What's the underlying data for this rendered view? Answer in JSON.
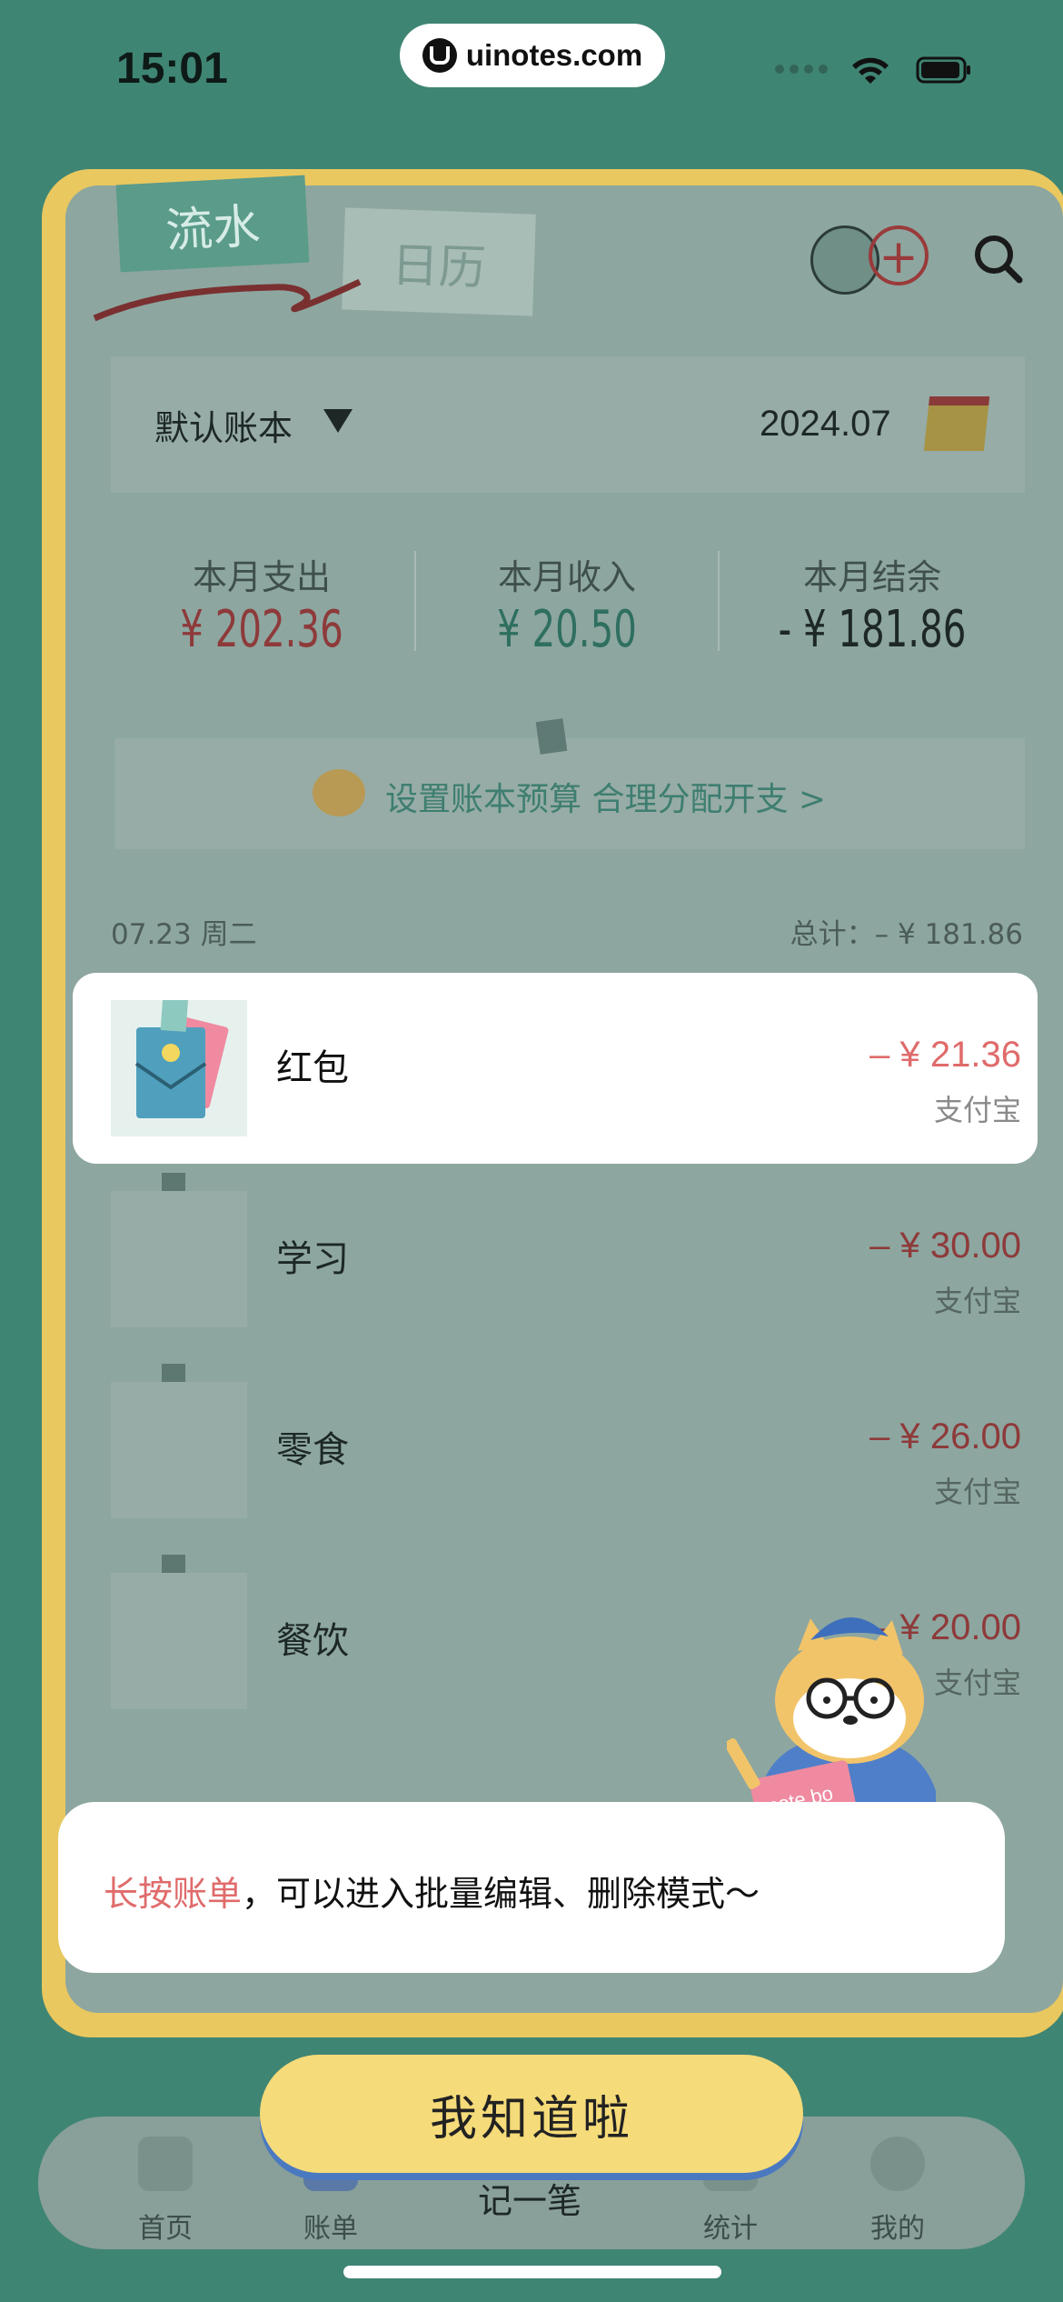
{
  "status": {
    "time": "15:01",
    "url": "uinotes.com"
  },
  "header": {
    "tab_flow": "流水",
    "tab_calendar": "日历"
  },
  "book": {
    "name": "默认账本",
    "month": "2024.07"
  },
  "summary": [
    {
      "label": "本月支出",
      "value": "¥ 202.36",
      "color": "#8e3a3a"
    },
    {
      "label": "本月收入",
      "value": "¥ 20.50",
      "color": "#2f6f60"
    },
    {
      "label": "本月结余",
      "value": "- ¥ 181.86",
      "color": "#1d2826"
    }
  ],
  "budget": {
    "text": "设置账本预算 合理分配开支 >"
  },
  "day": {
    "date": "07.23 周二",
    "total": "总计：– ¥ 181.86"
  },
  "transactions": [
    {
      "name": "红包",
      "amount": "– ¥ 21.36",
      "pay": "支付宝",
      "icon": "red-envelope-icon"
    },
    {
      "name": "学习",
      "amount": "– ¥ 30.00",
      "pay": "支付宝",
      "icon": "graduation-cap-icon"
    },
    {
      "name": "零食",
      "amount": "– ¥ 26.00",
      "pay": "支付宝",
      "icon": "ice-cream-icon"
    },
    {
      "name": "餐饮",
      "amount": "– ¥ 20.00",
      "pay": "支付宝",
      "icon": "burger-fries-icon"
    }
  ],
  "tip": {
    "highlight": "长按账单",
    "rest": "，可以进入批量编辑、删除模式～"
  },
  "ok_button": "我知道啦",
  "tabbar": {
    "home": "首页",
    "bill": "账单",
    "add": "记一笔",
    "stats": "统计",
    "mine": "我的"
  }
}
